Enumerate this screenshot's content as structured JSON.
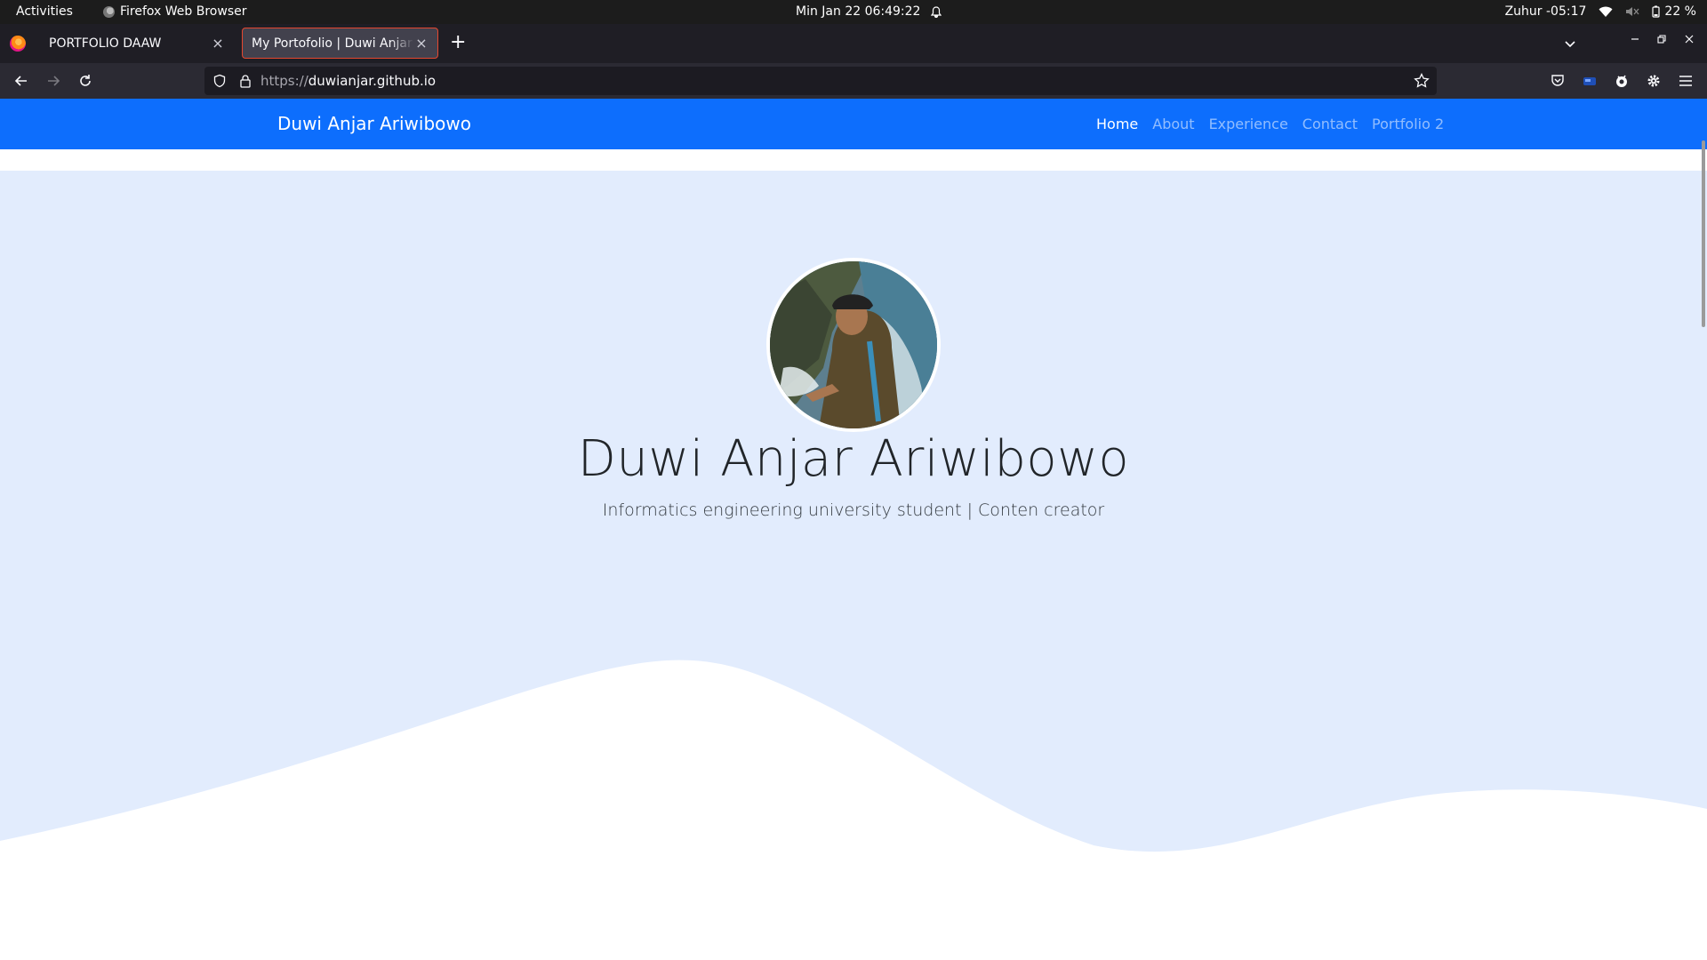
{
  "system_bar": {
    "activities": "Activities",
    "app_name": "Firefox Web Browser",
    "datetime": "Min Jan 22  06:49:22",
    "prayer": "Zuhur -05:17",
    "battery": "22 %"
  },
  "browser": {
    "tabs": [
      {
        "title": "PORTFOLIO DAAW",
        "active": false
      },
      {
        "title": "My Portofolio | Duwi Anjar Ariwibowo",
        "active": true
      }
    ],
    "url_protocol": "https://",
    "url_host": "duwianjar.github.io"
  },
  "site": {
    "brand": "Duwi Anjar Ariwibowo",
    "nav": [
      "Home",
      "About",
      "Experience",
      "Contact",
      "Portfolio 2"
    ],
    "active_nav": "Home",
    "hero_title": "Duwi Anjar Ariwibowo",
    "hero_subtitle": "Informatics engineering university student | Conten creator"
  },
  "colors": {
    "nav_bg": "#0d6efd",
    "hero_bg": "#e2ecfd",
    "tab_highlight": "#e6472f"
  },
  "icons": [
    "firefox-icon",
    "bell-icon",
    "wifi-icon",
    "volume-muted-icon",
    "battery-icon",
    "close-icon",
    "plus-icon",
    "chevron-down-icon",
    "back-icon",
    "forward-icon",
    "reload-icon",
    "shield-icon",
    "lock-icon",
    "star-icon",
    "pocket-icon",
    "extension-icon",
    "gear-icon",
    "menu-icon"
  ]
}
